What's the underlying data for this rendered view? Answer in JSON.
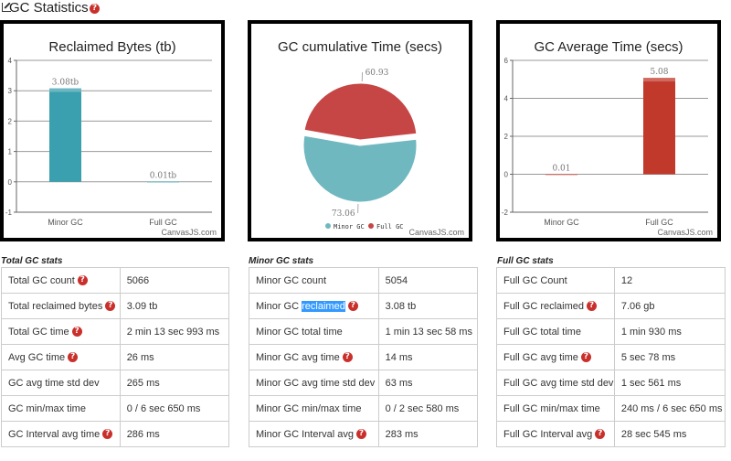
{
  "page": {
    "title": "GC Statistics",
    "help_glyph": "?"
  },
  "icons": {
    "external": "external-link-icon",
    "help": "help-icon"
  },
  "colors": {
    "teal": "#3a9fae",
    "red": "#c0392b",
    "pie_teal": "#6fb8c0",
    "pie_red": "#c64545",
    "help": "#c9302c"
  },
  "charts": {
    "reclaimed": {
      "title": "Reclaimed Bytes (tb)",
      "credit": "CanvasJS.com"
    },
    "cumulative": {
      "title": "GC cumulative Time (secs)",
      "credit": "CanvasJS.com"
    },
    "average": {
      "title": "GC Average Time (secs)",
      "credit": "CanvasJS.com"
    }
  },
  "chart_data": [
    {
      "type": "bar",
      "title": "Reclaimed Bytes (tb)",
      "categories": [
        "Minor GC",
        "Full GC"
      ],
      "values": [
        3.08,
        0.01
      ],
      "value_labels": [
        "3.08tb",
        "0.01tb"
      ],
      "ylim": [
        -1,
        4
      ],
      "yticks": [
        "-1",
        "0",
        "1",
        "2",
        "3",
        "4"
      ],
      "colors": [
        "#3a9fae",
        "#3a9fae"
      ],
      "grid": true
    },
    {
      "type": "pie",
      "title": "GC cumulative Time (secs)",
      "labels": [
        "Minor GC",
        "Full GC"
      ],
      "values": [
        73.06,
        60.93
      ],
      "value_labels": [
        "73.06",
        "60.93"
      ],
      "colors": [
        "#6fb8c0",
        "#c64545"
      ],
      "legend": "bottom"
    },
    {
      "type": "bar",
      "title": "GC Average Time (secs)",
      "categories": [
        "Minor GC",
        "Full GC"
      ],
      "values": [
        0.01,
        5.08
      ],
      "value_labels": [
        "0.01",
        "5.08"
      ],
      "ylim": [
        -2,
        6
      ],
      "yticks": [
        "-2",
        "0",
        "2",
        "4",
        "6"
      ],
      "colors": [
        "#c0392b",
        "#c0392b"
      ],
      "grid": true
    }
  ],
  "sections": {
    "total": "Total GC stats",
    "minor": "Minor GC stats",
    "full": "Full GC stats"
  },
  "tables": {
    "total": [
      {
        "label": "Total GC count",
        "help": true,
        "value": "5066"
      },
      {
        "label": "Total reclaimed bytes",
        "help": true,
        "value": "3.09 tb"
      },
      {
        "label": "Total GC time",
        "help": true,
        "value": "2 min 13 sec 993 ms"
      },
      {
        "label": "Avg GC time",
        "help": true,
        "value": "26 ms"
      },
      {
        "label": "GC avg time std dev",
        "help": false,
        "value": "265 ms"
      },
      {
        "label": "GC min/max time",
        "help": false,
        "value": "0 / 6 sec 650 ms"
      },
      {
        "label": "GC Interval avg time",
        "help": true,
        "value": "286 ms"
      }
    ],
    "minor": [
      {
        "label": "Minor GC count",
        "help": false,
        "value": "5054"
      },
      {
        "label": "Minor GC ",
        "label_hl": "reclaimed",
        "help": true,
        "value": "3.08 tb"
      },
      {
        "label": "Minor GC total time",
        "help": false,
        "value": "1 min 13 sec 58 ms"
      },
      {
        "label": "Minor GC avg time",
        "help": true,
        "value": "14 ms"
      },
      {
        "label": "Minor GC avg time std dev",
        "help": false,
        "value": "63 ms"
      },
      {
        "label": "Minor GC min/max time",
        "help": false,
        "value": "0 / 2 sec 580 ms"
      },
      {
        "label": "Minor GC Interval avg",
        "help": true,
        "value": "283 ms"
      }
    ],
    "full": [
      {
        "label": "Full GC Count",
        "help": false,
        "value": "12"
      },
      {
        "label": "Full GC reclaimed",
        "help": true,
        "value": "7.06 gb"
      },
      {
        "label": "Full GC total time",
        "help": false,
        "value": "1 min 930 ms"
      },
      {
        "label": "Full GC avg time",
        "help": true,
        "value": "5 sec 78 ms"
      },
      {
        "label": "Full GC avg time std dev",
        "help": false,
        "value": "1 sec 561 ms"
      },
      {
        "label": "Full GC min/max time",
        "help": false,
        "value": "240 ms / 6 sec 650 ms"
      },
      {
        "label": "Full GC Interval avg",
        "help": true,
        "value": "28 sec 545 ms"
      }
    ]
  }
}
